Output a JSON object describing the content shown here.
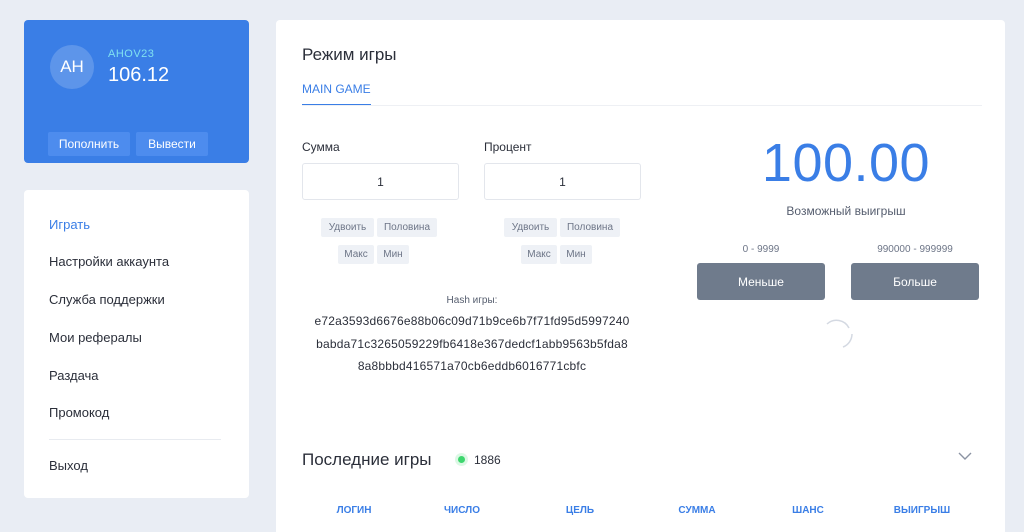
{
  "profile": {
    "avatar_initials": "AH",
    "username": "AHOV23",
    "balance": "106.12",
    "deposit_label": "Пополнить",
    "withdraw_label": "Вывести",
    "accent_color": "#3a7ee6"
  },
  "menu": {
    "items": [
      {
        "label": "Играть",
        "active": true
      },
      {
        "label": "Настройки аккаунта"
      },
      {
        "label": "Служба поддержки"
      },
      {
        "label": "Мои рефералы"
      },
      {
        "label": "Раздача"
      },
      {
        "label": "Промокод"
      }
    ],
    "logout_label": "Выход"
  },
  "game": {
    "title": "Режим игры",
    "tab": "MAIN GAME",
    "sum": {
      "label": "Сумма",
      "value": "1",
      "double": "Удвоить",
      "half": "Половина",
      "max": "Макс",
      "min": "Мин"
    },
    "percent": {
      "label": "Процент",
      "value": "1",
      "double": "Удвоить",
      "half": "Половина",
      "max": "Макс",
      "min": "Мин"
    },
    "hash_label": "Hash игры:",
    "hash_lines": [
      "e72a3593d6676e88b06c09d71b9ce6b7f71fd95d5997240",
      "babda71c3265059229fb6418e367dedcf1abb9563b5fda8",
      "8a8bbbd416571a70cb6eddb6016771cbfc"
    ],
    "possible_win": "100.00",
    "possible_win_label": "Возможный выигрыш",
    "less": {
      "range": "0 - 9999",
      "label": "Меньше"
    },
    "more": {
      "range": "990000 - 999999",
      "label": "Больше"
    }
  },
  "last_games": {
    "title": "Последние игры",
    "online_count": "1886",
    "columns": [
      "ЛОГИН",
      "ЧИСЛО",
      "ЦЕЛЬ",
      "СУММА",
      "ШАНС",
      "ВЫИГРЫШ"
    ]
  }
}
